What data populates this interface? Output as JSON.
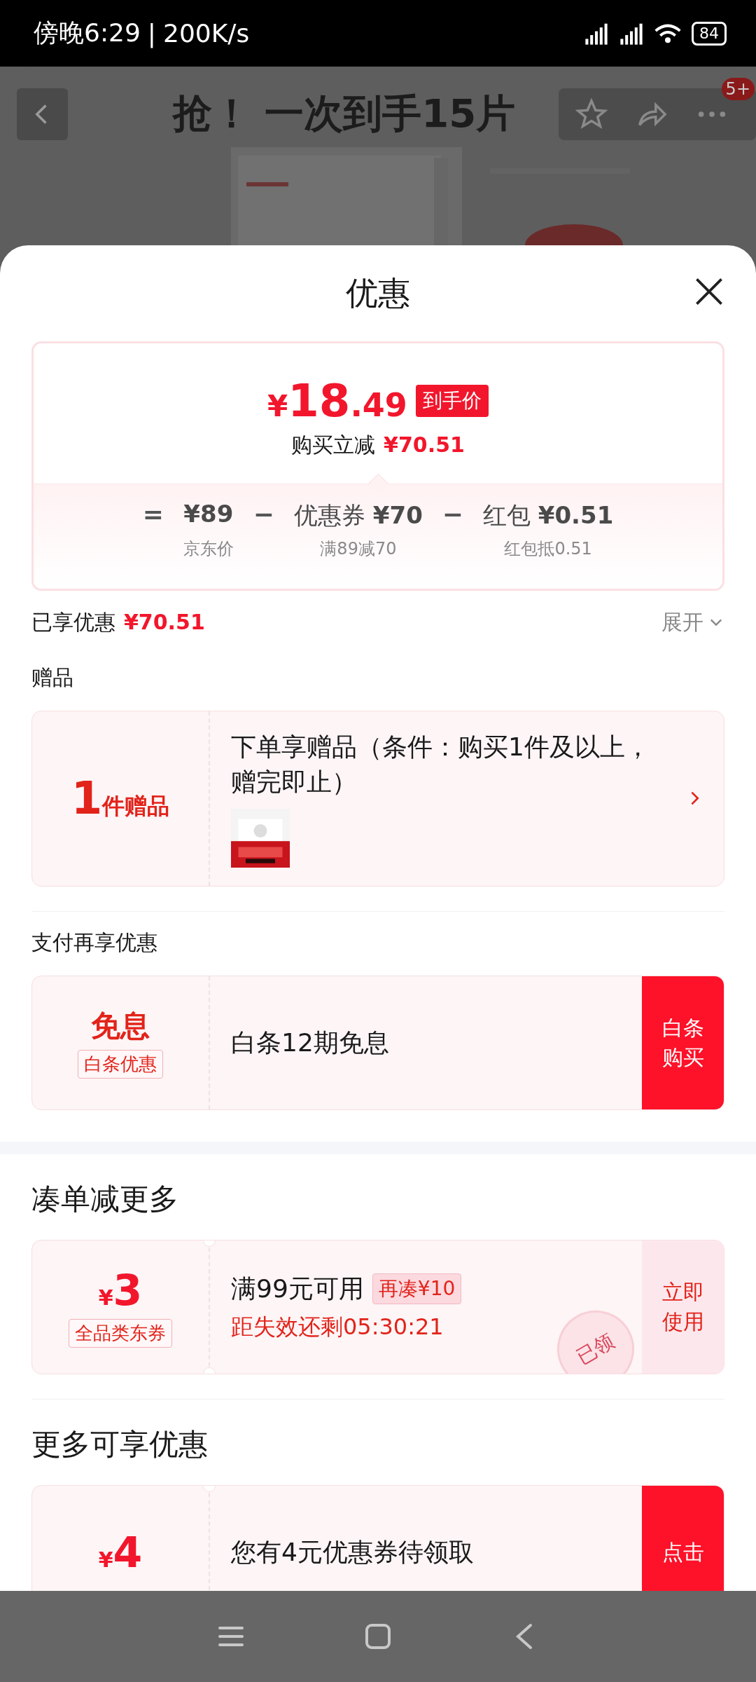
{
  "status_bar": {
    "time": "傍晚6:29",
    "separator": "|",
    "speed": "200K/s",
    "battery": "84"
  },
  "background_page": {
    "title": "抢！  一次到手15片",
    "badge": "5+"
  },
  "sheet": {
    "title": "优惠"
  },
  "price_card": {
    "currency": "¥",
    "price_int": "18",
    "price_dec": ".49",
    "price_tag": "到手价",
    "saving_label": "购买立减",
    "saving_amount": "¥70.51",
    "equals": "=",
    "terms": [
      {
        "value": "¥89",
        "caption": "京东价"
      },
      {
        "operator": "−",
        "label": "优惠券",
        "value": "¥70",
        "caption": "满89减70"
      },
      {
        "operator": "−",
        "label": "红包",
        "value": "¥0.51",
        "caption": "红包抵0.51"
      }
    ]
  },
  "discount_summary": {
    "label": "已享优惠",
    "amount": "¥70.51",
    "toggle": "展开",
    "expanded": false
  },
  "groups": [
    [
      {
        "kind": "gift",
        "heading": "赠品",
        "count": "1",
        "unit": "件赠品",
        "text": "下单享赠品（条件：购买1件及以上，赠完即止）"
      },
      {
        "kind": "payment",
        "heading": "支付再享优惠",
        "badge_title": "免息",
        "badge_tag": "白条优惠",
        "text": "白条12期免息",
        "action": "白条购买",
        "action_filled": true
      }
    ],
    [
      {
        "kind": "coupon",
        "heading": "凑单减更多",
        "currency": "¥",
        "amount": "3",
        "tag": "全品类东券",
        "text": "满99元可用",
        "chip": "再凑¥10",
        "countdown": "距失效还剩05:30:21",
        "action": "立即使用",
        "action_filled": false,
        "claimed": true,
        "stamp": "已领"
      },
      {
        "kind": "coupon",
        "heading": "更多可享优惠",
        "currency": "¥",
        "amount": "4",
        "text": "您有4元优惠券待领取",
        "action": "点击",
        "action_filled": true,
        "claimed": false
      }
    ]
  ]
}
